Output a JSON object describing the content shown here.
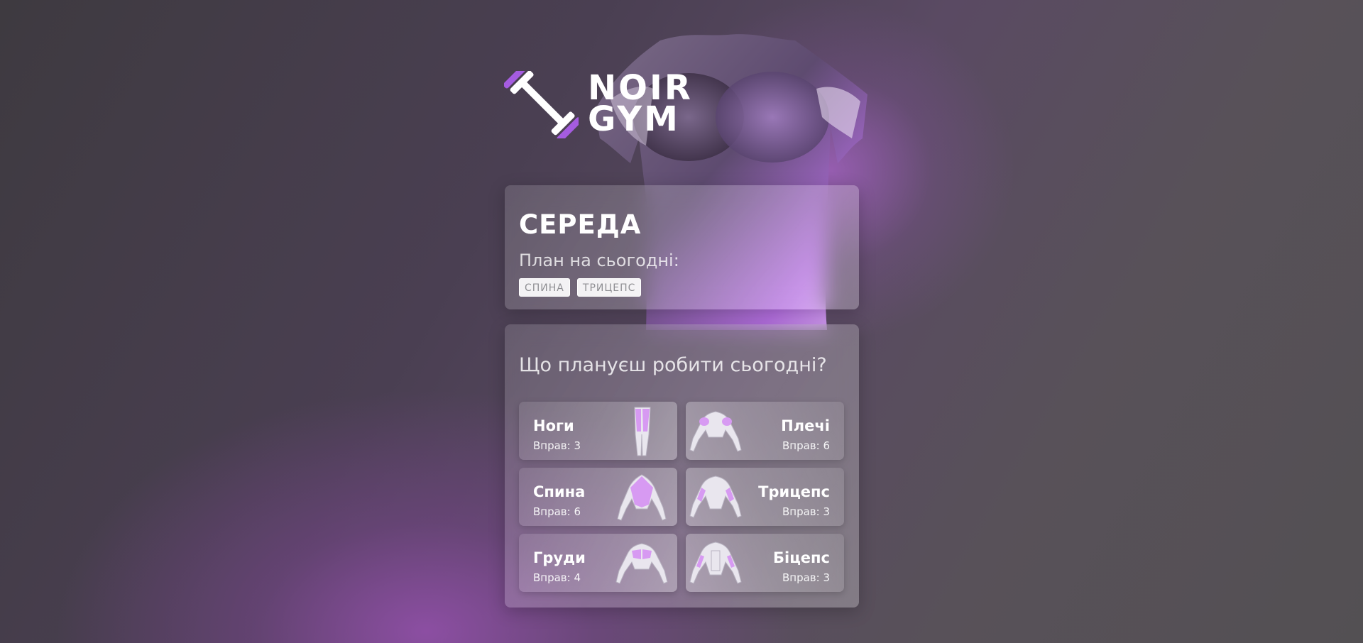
{
  "brand": {
    "line1": "NOIR",
    "line2": "GYM",
    "accent": "#a55ce0"
  },
  "day_card": {
    "day": "СЕРЕДА",
    "plan_label": "План на сьогодні:",
    "tags": [
      "СПИНА",
      "ТРИЦЕПС"
    ]
  },
  "plan_card": {
    "question": "Що плануєш робити сьогодні?",
    "muscles": [
      {
        "name": "Ноги",
        "count": "Вправ: 3",
        "icon": "legs-icon"
      },
      {
        "name": "Плечі",
        "count": "Вправ: 6",
        "icon": "shoulders-icon"
      },
      {
        "name": "Спина",
        "count": "Вправ: 6",
        "icon": "back-icon"
      },
      {
        "name": "Трицепс",
        "count": "Вправ: 3",
        "icon": "triceps-icon"
      },
      {
        "name": "Груди",
        "count": "Вправ: 4",
        "icon": "chest-icon"
      },
      {
        "name": "Біцепс",
        "count": "Вправ: 3",
        "icon": "biceps-icon"
      }
    ]
  },
  "colors": {
    "highlight_muscle": "#d79af2",
    "body_outline": "#e9e6ee"
  }
}
